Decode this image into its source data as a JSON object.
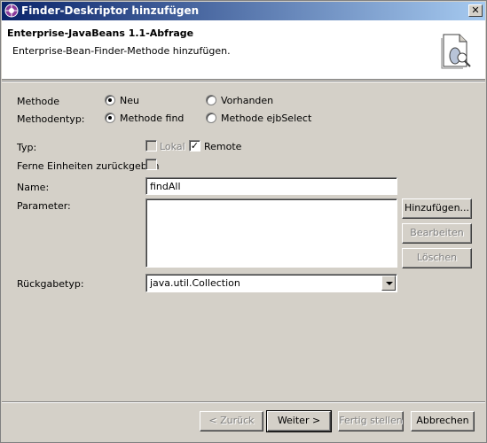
{
  "window": {
    "title": "Finder-Deskriptor hinzufügen",
    "close_glyph": "✕"
  },
  "banner": {
    "heading": "Enterprise-JavaBeans 1.1-Abfrage",
    "description": "Enterprise-Bean-Finder-Methode hinzufügen.",
    "icon": "bean-finder-wizard-icon"
  },
  "form": {
    "methode": {
      "label": "Methode",
      "options": [
        "Neu",
        "Vorhanden"
      ],
      "selected": "Neu"
    },
    "methodentyp": {
      "label": "Methodentyp:",
      "options": [
        "Methode find",
        "Methode ejbSelect"
      ],
      "selected": "Methode find"
    },
    "typ": {
      "label": "Typ:",
      "lokal": {
        "label": "Lokal",
        "checked": false,
        "enabled": false
      },
      "remote": {
        "label": "Remote",
        "checked": true,
        "enabled": true
      }
    },
    "ferne": {
      "label": "Ferne Einheiten zurückgeben",
      "checked": false
    },
    "name": {
      "label": "Name:",
      "value": "findAll"
    },
    "parameter": {
      "label": "Parameter:",
      "items": []
    },
    "rueckgabetyp": {
      "label": "Rückgabetyp:",
      "value": "java.util.Collection"
    }
  },
  "param_buttons": {
    "add": "Hinzufügen...",
    "edit": "Bearbeiten",
    "delete": "Löschen"
  },
  "footer": {
    "back": "< Zurück",
    "next": "Weiter >",
    "finish": "Fertig stellen",
    "cancel": "Abbrechen"
  }
}
